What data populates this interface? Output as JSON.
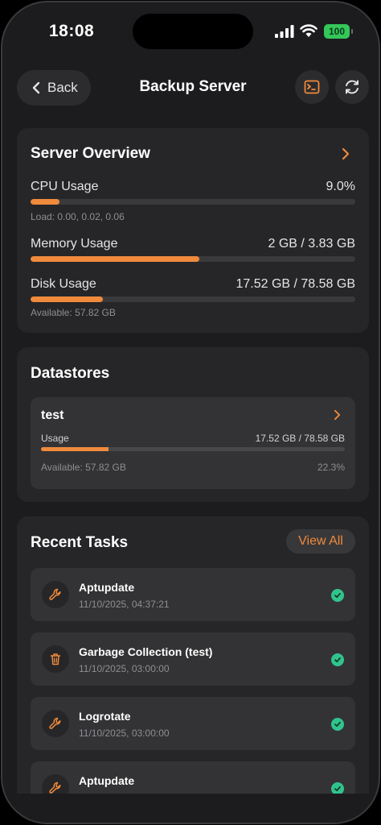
{
  "status_bar": {
    "time": "18:08",
    "battery": "100"
  },
  "nav": {
    "back_label": "Back",
    "title": "Backup Server"
  },
  "overview": {
    "title": "Server Overview",
    "cpu": {
      "label": "CPU Usage",
      "value": "9.0%",
      "fraction": 0.09,
      "note": "Load: 0.00, 0.02, 0.06"
    },
    "memory": {
      "label": "Memory Usage",
      "value": "2 GB / 3.83 GB",
      "fraction": 0.52
    },
    "disk": {
      "label": "Disk Usage",
      "value": "17.52 GB / 78.58 GB",
      "fraction": 0.223,
      "note": "Available: 57.82 GB"
    }
  },
  "datastores": {
    "title": "Datastores",
    "items": [
      {
        "name": "test",
        "usage_label": "Usage",
        "usage_value": "17.52 GB / 78.58 GB",
        "fraction": 0.223,
        "available": "Available: 57.82 GB",
        "percent": "22.3%"
      }
    ]
  },
  "tasks": {
    "title": "Recent Tasks",
    "view_all": "View All",
    "items": [
      {
        "name": "Aptupdate",
        "time": "11/10/2025, 04:37:21",
        "icon": "wrench-icon",
        "status": "success"
      },
      {
        "name": "Garbage Collection (test)",
        "time": "11/10/2025, 03:00:00",
        "icon": "trash-icon",
        "status": "success"
      },
      {
        "name": "Logrotate",
        "time": "11/10/2025, 03:00:00",
        "icon": "wrench-icon",
        "status": "success"
      },
      {
        "name": "Aptupdate",
        "time": "",
        "icon": "wrench-icon",
        "status": "success"
      }
    ]
  },
  "colors": {
    "accent": "#f08a3c",
    "success": "#30c48d",
    "card": "#262628",
    "background": "#1c1c1e"
  }
}
